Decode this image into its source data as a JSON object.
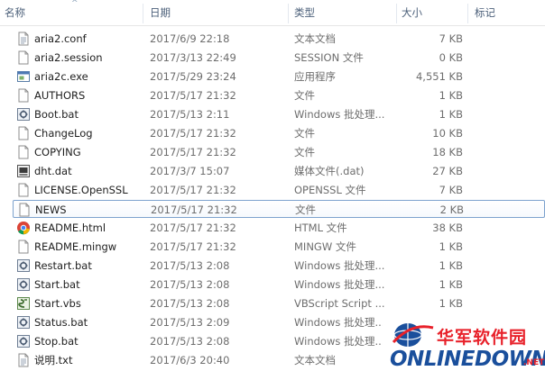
{
  "columns": {
    "name": "名称",
    "date": "日期",
    "type": "类型",
    "size": "大小",
    "tags": "标记"
  },
  "files": [
    {
      "name": "aria2.conf",
      "date": "2017/6/9 22:18",
      "type": "文本文档",
      "size": "7 KB",
      "icon": "text-file-icon"
    },
    {
      "name": "aria2.session",
      "date": "2017/3/13 22:49",
      "type": "SESSION 文件",
      "size": "0 KB",
      "icon": "generic-file-icon"
    },
    {
      "name": "aria2c.exe",
      "date": "2017/5/29 23:24",
      "type": "应用程序",
      "size": "4,551 KB",
      "icon": "exe-file-icon"
    },
    {
      "name": "AUTHORS",
      "date": "2017/5/17 21:32",
      "type": "文件",
      "size": "1 KB",
      "icon": "generic-file-icon"
    },
    {
      "name": "Boot.bat",
      "date": "2017/5/13 2:11",
      "type": "Windows 批处理...",
      "size": "1 KB",
      "icon": "bat-file-icon"
    },
    {
      "name": "ChangeLog",
      "date": "2017/5/17 21:32",
      "type": "文件",
      "size": "10 KB",
      "icon": "generic-file-icon"
    },
    {
      "name": "COPYING",
      "date": "2017/5/17 21:32",
      "type": "文件",
      "size": "18 KB",
      "icon": "generic-file-icon"
    },
    {
      "name": "dht.dat",
      "date": "2017/3/7 15:07",
      "type": "媒体文件(.dat)",
      "size": "27 KB",
      "icon": "media-file-icon"
    },
    {
      "name": "LICENSE.OpenSSL",
      "date": "2017/5/17 21:32",
      "type": "OPENSSL 文件",
      "size": "7 KB",
      "icon": "generic-file-icon"
    },
    {
      "name": "NEWS",
      "date": "2017/5/17 21:32",
      "type": "文件",
      "size": "2 KB",
      "icon": "generic-file-icon",
      "selected": true
    },
    {
      "name": "README.html",
      "date": "2017/5/17 21:32",
      "type": "HTML 文件",
      "size": "38 KB",
      "icon": "chrome-html-icon"
    },
    {
      "name": "README.mingw",
      "date": "2017/5/17 21:32",
      "type": "MINGW 文件",
      "size": "1 KB",
      "icon": "generic-file-icon"
    },
    {
      "name": "Restart.bat",
      "date": "2017/5/13 2:08",
      "type": "Windows 批处理...",
      "size": "1 KB",
      "icon": "bat-file-icon"
    },
    {
      "name": "Start.bat",
      "date": "2017/5/13 2:08",
      "type": "Windows 批处理...",
      "size": "1 KB",
      "icon": "bat-file-icon"
    },
    {
      "name": "Start.vbs",
      "date": "2017/5/13 2:08",
      "type": "VBScript Script ...",
      "size": "1 KB",
      "icon": "vbs-file-icon"
    },
    {
      "name": "Status.bat",
      "date": "2017/5/13 2:09",
      "type": "Windows 批处理...",
      "size": "1 KB",
      "icon": "bat-file-icon"
    },
    {
      "name": "Stop.bat",
      "date": "2017/5/13 2:08",
      "type": "Windows 批处理...",
      "size": "1 KB",
      "icon": "bat-file-icon"
    },
    {
      "name": "说明.txt",
      "date": "2017/6/3 20:40",
      "type": "文本文档",
      "size": "1 KB",
      "icon": "text-file-icon"
    }
  ],
  "watermark": {
    "cn": "华军软件园",
    "en": "ONLINEDOWN",
    "suffix": ".NET"
  },
  "colors": {
    "header_text": "#4c607a",
    "selection_border": "#7da2ce",
    "watermark_red": "#e8212a",
    "watermark_blue": "#1a4f9c"
  }
}
